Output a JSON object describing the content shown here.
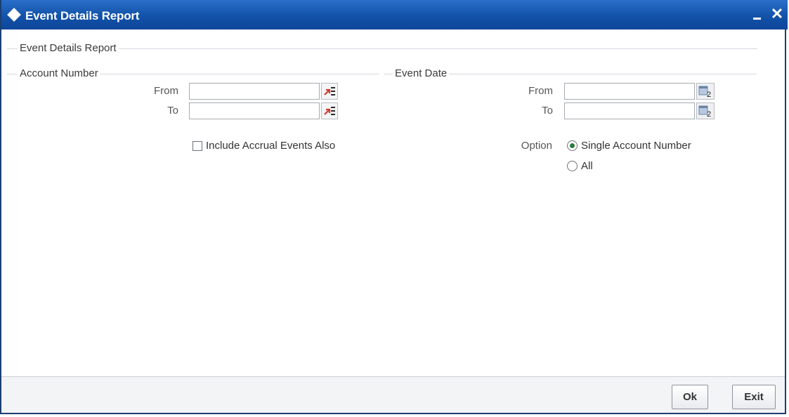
{
  "window": {
    "title": "Event Details Report"
  },
  "main": {
    "section_title": "Event Details Report",
    "account_number": {
      "title": "Account Number",
      "from_label": "From",
      "to_label": "To",
      "from_value": "",
      "to_value": "",
      "include_accrual_label": "Include Accrual Events Also",
      "include_accrual_checked": false
    },
    "event_date": {
      "title": "Event Date",
      "from_label": "From",
      "to_label": "To",
      "from_value": "",
      "to_value": "",
      "calendar_badge": "2"
    },
    "option": {
      "label": "Option",
      "choices": [
        "Single Account Number",
        "All"
      ],
      "selected": "Single Account Number"
    }
  },
  "footer": {
    "ok_label": "Ok",
    "exit_label": "Exit"
  },
  "colors": {
    "titlebar": "#1252a8",
    "lov_arrow": "#d43a2f",
    "radio_selected": "#2c7a3b"
  },
  "icons": {
    "lov": "list-of-values-icon",
    "calendar": "calendar-icon",
    "minimize": "minimize-icon",
    "close": "close-icon"
  }
}
